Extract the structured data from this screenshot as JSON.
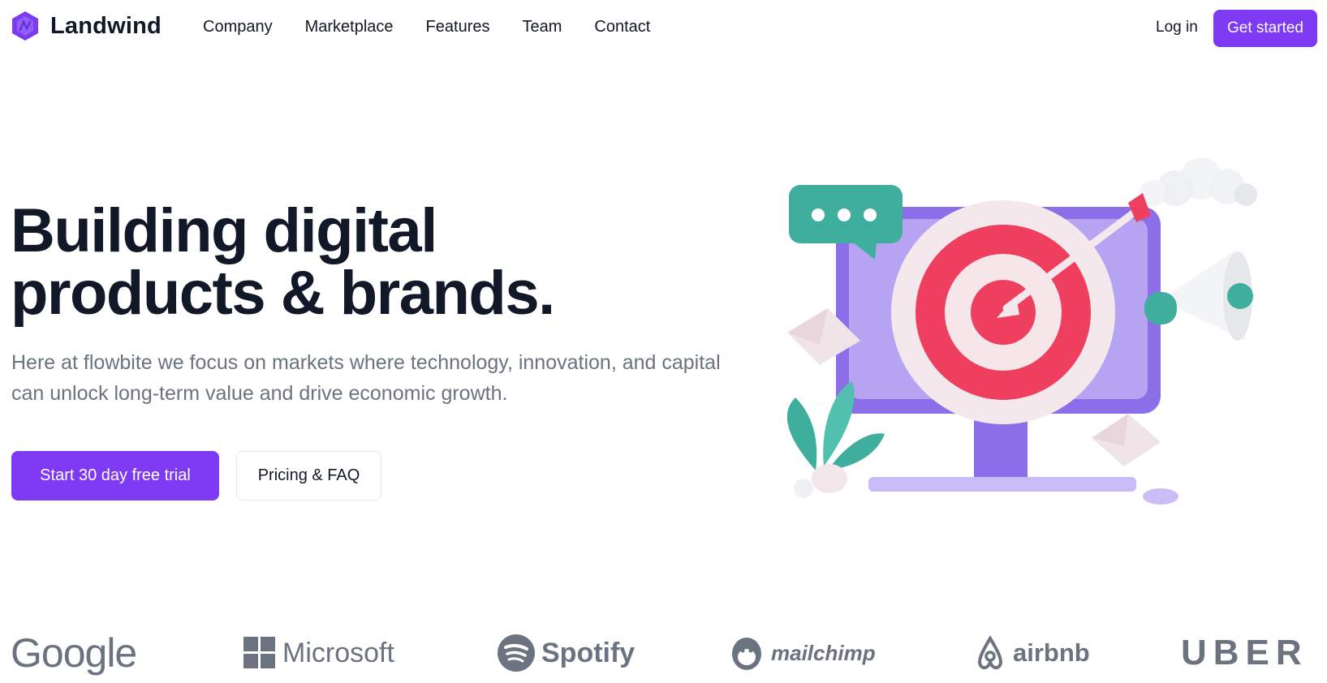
{
  "colors": {
    "primary": "#7e3af2",
    "text_dark": "#111827",
    "text_muted": "#6b7280"
  },
  "nav": {
    "brand_name": "Landwind",
    "brand_icon": "landwind-hexagon-logo",
    "links": [
      "Company",
      "Marketplace",
      "Features",
      "Team",
      "Contact"
    ],
    "login_label": "Log in",
    "cta_label": "Get started"
  },
  "hero": {
    "title_line1": "Building digital",
    "title_line2": "products & brands.",
    "subtitle": "Here at flowbite we focus on markets where technology, innovation, and capital can unlock long-term value and drive economic growth.",
    "primary_button": "Start 30 day free trial",
    "secondary_button": "Pricing & FAQ"
  },
  "logos": {
    "google": "Google",
    "microsoft": "Microsoft",
    "spotify": "Spotify",
    "mailchimp": "mailchimp",
    "airbnb": "airbnb",
    "uber": "UBER"
  }
}
